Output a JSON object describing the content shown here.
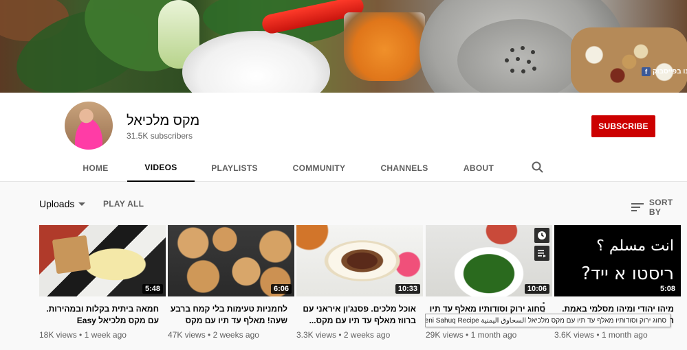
{
  "banner": {
    "facebook_link": "לנו בפייסבוק",
    "facebook_icon": "facebook-icon"
  },
  "channel": {
    "name": "מקס מלכיאל",
    "subscribers": "31.5K subscribers",
    "subscribe_label": "SUBSCRIBE",
    "subscribe_color": "#cc0000"
  },
  "tabs": [
    {
      "label": "HOME",
      "active": false
    },
    {
      "label": "VIDEOS",
      "active": true
    },
    {
      "label": "PLAYLISTS",
      "active": false
    },
    {
      "label": "COMMUNITY",
      "active": false
    },
    {
      "label": "CHANNELS",
      "active": false
    },
    {
      "label": "ABOUT",
      "active": false
    }
  ],
  "toolbar": {
    "uploads_label": "Uploads",
    "play_all_label": "PLAY ALL",
    "sort_label": "SORT BY"
  },
  "videos": [
    {
      "title": "חמאה ביתית בקלות ובמהירות. עם מקס מלכיאל Easy Homemade...",
      "views": "18K views",
      "age": "1 week ago",
      "duration": "5:48"
    },
    {
      "title": "לחמניות טעימות בלי קמח ברבע שעה! מאלף עד תיו עם מקס",
      "views": "47K views",
      "age": "2 weeks ago",
      "duration": "6:06"
    },
    {
      "title": "אוכל מלכים. פסנג'ון איראני עם ברווז מאלף עד תיו עם מקס...",
      "views": "3.3K views",
      "age": "2 weeks ago",
      "duration": "10:33"
    },
    {
      "title": "סחוג ירוק וסודותיו מאלף עד תיו עם מקס מלכיאל",
      "views": "29K views",
      "age": "1 month ago",
      "duration": "10:06"
    },
    {
      "title": "מיהו יהודי ומיהו מסלמי באמת. היסטוריה...",
      "views": "3.6K views",
      "age": "1 month ago",
      "duration": "5:08",
      "thumb_text_1": "انت مسلم ؟",
      "thumb_text_2": "ריסטו א ייד?"
    }
  ],
  "tooltip": "Yemeni Sahuq Recipe סחוג ירוק וסודותיו מאלף עד תיו עם מקס מלכיאל السحاوق اليمنية"
}
